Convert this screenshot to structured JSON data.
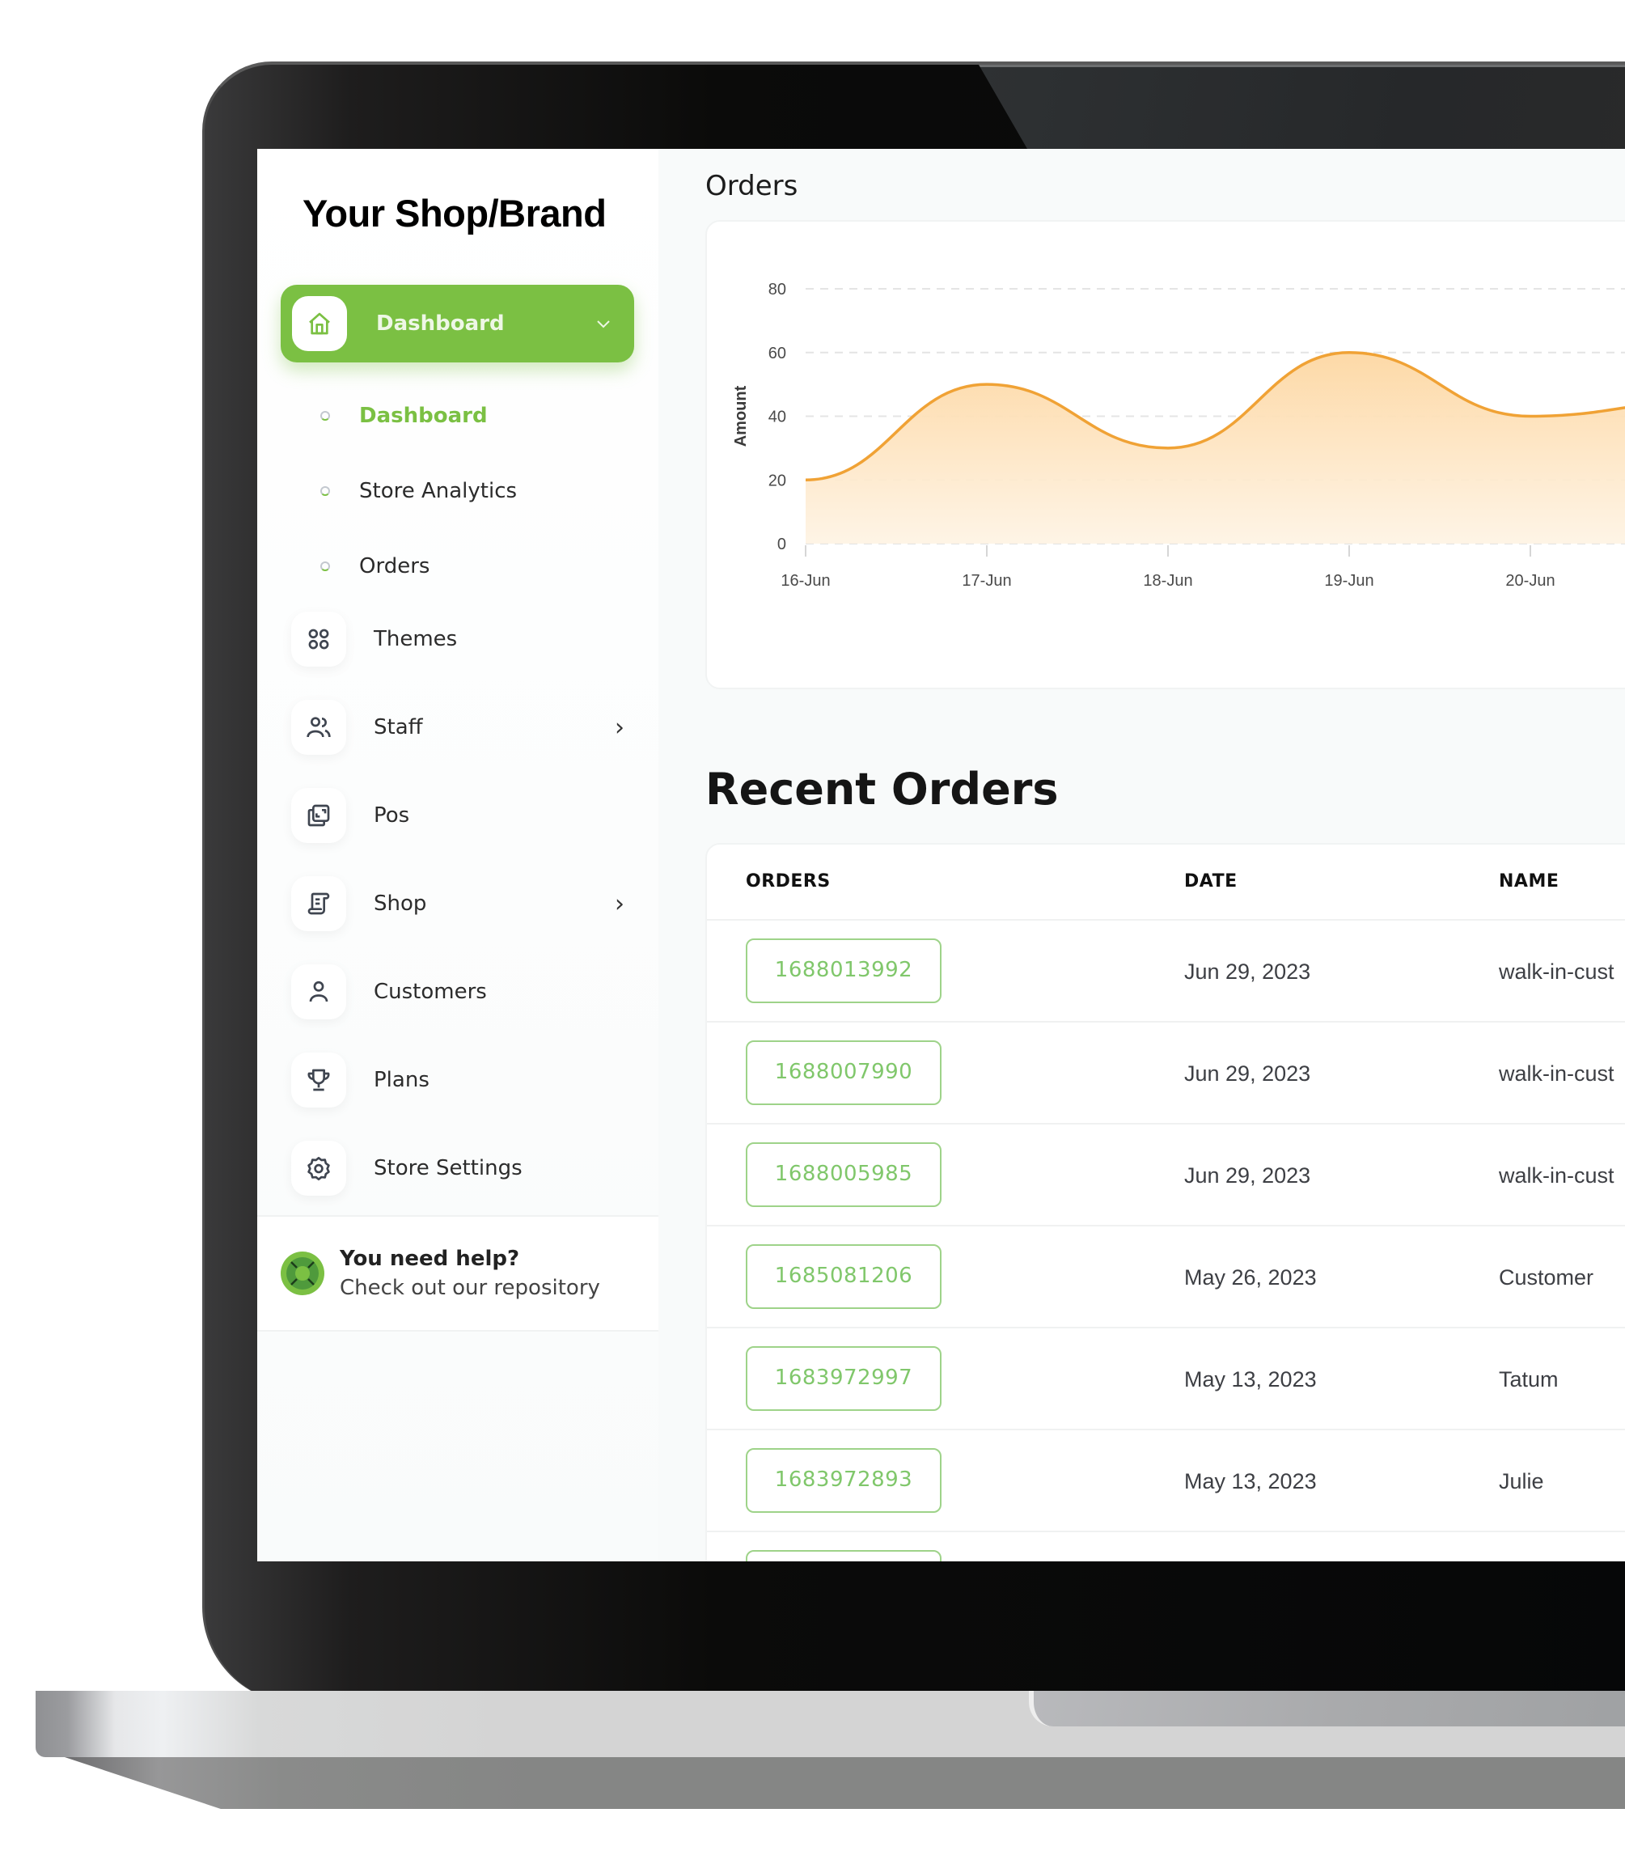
{
  "brand": {
    "name": "Your Shop/Brand"
  },
  "theme": {
    "accent": "#7bc043",
    "chart_line": "#f0a235",
    "chart_fill": "#fdd9a8"
  },
  "sidebar": {
    "active": {
      "label": "Dashboard",
      "icon": "home-icon"
    },
    "subitems": [
      {
        "label": "Dashboard",
        "active": true
      },
      {
        "label": "Store Analytics",
        "active": false
      },
      {
        "label": "Orders",
        "active": false
      }
    ],
    "items": [
      {
        "label": "Themes",
        "icon": "grid-icon",
        "has_submenu": false
      },
      {
        "label": "Staff",
        "icon": "users-icon",
        "has_submenu": true
      },
      {
        "label": "Pos",
        "icon": "pos-icon",
        "has_submenu": false
      },
      {
        "label": "Shop",
        "icon": "scroll-icon",
        "has_submenu": true
      },
      {
        "label": "Customers",
        "icon": "user-icon",
        "has_submenu": false
      },
      {
        "label": "Plans",
        "icon": "trophy-icon",
        "has_submenu": false
      },
      {
        "label": "Store Settings",
        "icon": "gear-icon",
        "has_submenu": false
      }
    ],
    "chevron_right": "›",
    "chevron_down": "⌄",
    "help": {
      "title": "You need help?",
      "subtitle": "Check out our repository"
    }
  },
  "main": {
    "orders_title": "Orders",
    "recent_title": "Recent Orders",
    "table": {
      "headers": [
        "ORDERS",
        "DATE",
        "NAME"
      ],
      "rows": [
        {
          "order": "1688013992",
          "date": "Jun 29, 2023",
          "name": "walk-in-cust"
        },
        {
          "order": "1688007990",
          "date": "Jun 29, 2023",
          "name": "walk-in-cust"
        },
        {
          "order": "1688005985",
          "date": "Jun 29, 2023",
          "name": "walk-in-cust"
        },
        {
          "order": "1685081206",
          "date": "May 26, 2023",
          "name": "Customer"
        },
        {
          "order": "1683972997",
          "date": "May 13, 2023",
          "name": "Tatum"
        },
        {
          "order": "1683972893",
          "date": "May 13, 2023",
          "name": "Julie"
        },
        {
          "order": "",
          "date": "",
          "name": ""
        }
      ]
    }
  },
  "chart_data": {
    "type": "area",
    "title": "Orders",
    "xlabel": "",
    "ylabel": "Amount",
    "categories": [
      "16-Jun",
      "17-Jun",
      "18-Jun",
      "19-Jun",
      "20-Jun"
    ],
    "series": [
      {
        "name": "Amount",
        "values": [
          20,
          50,
          30,
          60,
          40
        ],
        "trailing_partial_value": 45
      }
    ],
    "yticks": [
      0,
      20,
      40,
      60,
      80
    ],
    "ylim": [
      0,
      80
    ],
    "grid": true,
    "curve": "smooth"
  }
}
